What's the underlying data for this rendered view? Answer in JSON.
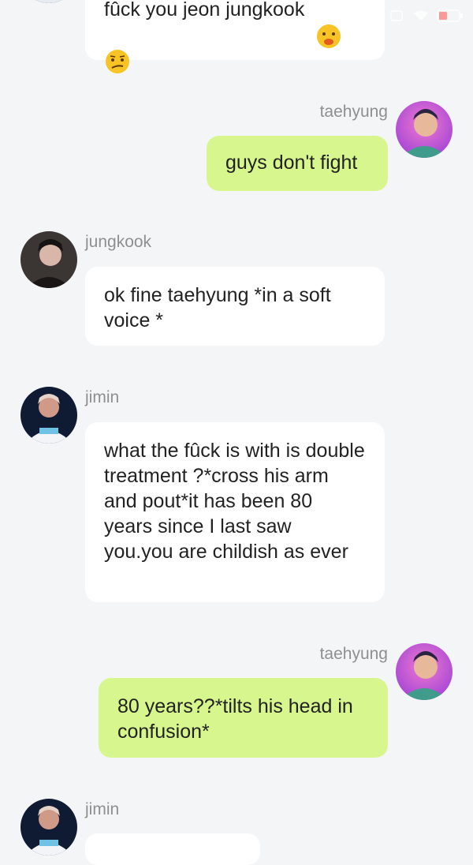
{
  "status_bar": {
    "left_text": "",
    "icons": [
      "alarm-icon",
      "wifi-icon",
      "battery-icon"
    ]
  },
  "messages": [
    {
      "side": "left",
      "avatar_icon": "jimin-avatar-icon",
      "text_line1": "fûck you jeon jungkook",
      "emoji1": "😤",
      "emoji2": "😕"
    },
    {
      "side": "right",
      "sender": "taehyung",
      "avatar_icon": "taehyung-avatar-icon",
      "text": "guys don't fight"
    },
    {
      "side": "left",
      "sender": "jungkook",
      "avatar_icon": "jungkook-avatar-icon",
      "text": "ok fine taehyung *in a soft voice *"
    },
    {
      "side": "left",
      "sender": "jimin",
      "avatar_icon": "jimin-avatar-icon",
      "text": "what the fûck is with is double treatment ?*cross his arm and pout*it has been 80 years since I last saw you.you are childish as ever"
    },
    {
      "side": "right",
      "sender": "taehyung",
      "avatar_icon": "taehyung-avatar-icon",
      "text": "80 years??*tilts his head in confusion*"
    },
    {
      "side": "left",
      "sender": "jimin",
      "avatar_icon": "jimin-avatar-icon",
      "text": ""
    }
  ],
  "colors": {
    "background": "#f4f5f7",
    "incoming_bubble": "#ffffff",
    "outgoing_bubble": "#d7f68d",
    "sender_name": "#8f8f8f"
  }
}
